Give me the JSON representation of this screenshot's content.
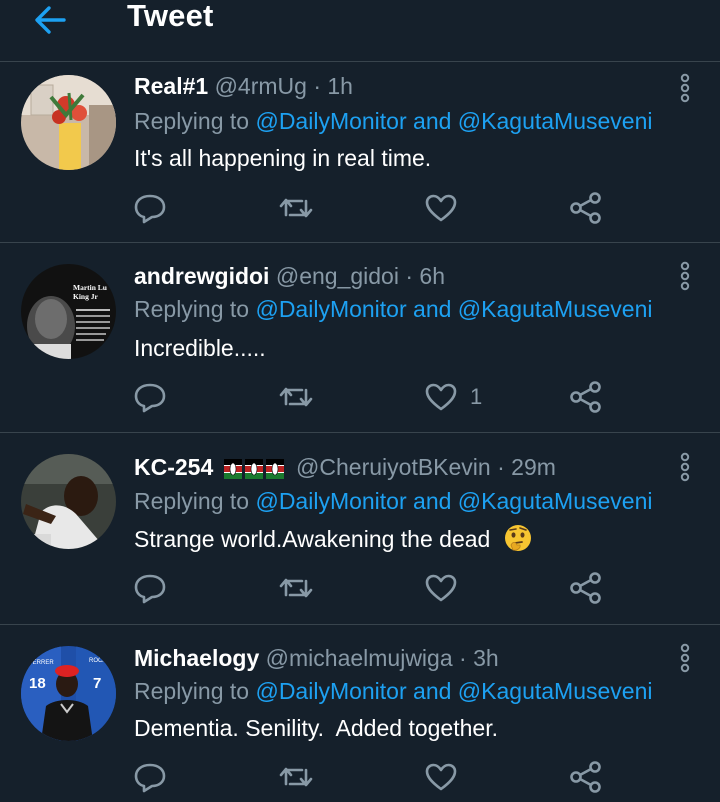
{
  "header": {
    "title": "Tweet",
    "back_icon": "arrow-left-icon",
    "accent": "#1da1f2"
  },
  "colors": {
    "background": "#15202b",
    "divider": "#38444d",
    "secondary": "#8899a6",
    "link": "#1da1f2"
  },
  "tweets": [
    {
      "name": "Real#1",
      "handle": "@4rmUg",
      "sep": "·",
      "time": "1h",
      "reply_prefix": "Replying to",
      "mention1": "@DailyMonitor",
      "and": "and",
      "mention2": "@KagutaMuseveni",
      "text": "It's all happening in real time.",
      "likes": ""
    },
    {
      "name": "andrewgidoi",
      "handle": "@eng_gidoi",
      "sep": "·",
      "time": "6h",
      "reply_prefix": "Replying to",
      "mention1": "@DailyMonitor",
      "and": "and",
      "mention2": "@KagutaMuseveni",
      "text": "Incredible.....",
      "likes": "1",
      "avatar_text": {
        "line1": "Martin Lu",
        "line2": "King Jr"
      }
    },
    {
      "name": "KC-254",
      "handle": "@CheruiyotBKevin",
      "sep": "·",
      "time": "29m",
      "reply_prefix": "Replying to",
      "mention1": "@DailyMonitor",
      "and": "and",
      "mention2": "@KagutaMuseveni",
      "text": "Strange world.Awakening the dead",
      "likes": "",
      "emoji": "thinking-face-emoji",
      "flag_icons": [
        "kenya-flag-icon",
        "kenya-flag-icon",
        "kenya-flag-icon"
      ]
    },
    {
      "name": "Michaelogy",
      "handle": "@michaelmujwiga",
      "sep": "·",
      "time": "3h",
      "reply_prefix": "Replying to",
      "mention1": "@DailyMonitor",
      "and": "and",
      "mention2": "@KagutaMuseveni",
      "text": "Dementia. Senility.  Added together.",
      "likes": "",
      "jersey_numbers": [
        "18",
        "7"
      ]
    }
  ]
}
